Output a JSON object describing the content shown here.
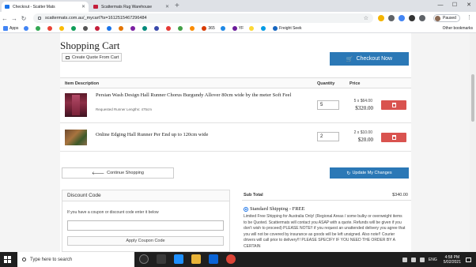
{
  "browser": {
    "tabs": [
      {
        "title": "Checkout - Scatter Mats",
        "active": true
      },
      {
        "title": "Scattermats Rug Warehouse",
        "active": false
      }
    ],
    "url": "scattermats.com.au/_mycart?ts=1612515467296484",
    "profile_label": "Paused",
    "bookmarks": [
      {
        "label": "Apps",
        "icon": "apps-grid-icon"
      },
      {
        "label": "365",
        "icon": "office-icon"
      },
      {
        "label": "YF",
        "icon": "bookmark-icon"
      },
      {
        "label": "Freight Seek",
        "icon": "freight-icon"
      }
    ],
    "other_bookmarks": "Other bookmarks"
  },
  "cart": {
    "title": "Shopping Cart",
    "create_quote_label": "Create Quote From Cart",
    "checkout_label": "Checkout Now",
    "columns": {
      "description": "Item Description",
      "quantity": "Quantity",
      "price": "Price"
    },
    "items": [
      {
        "name": "Persian Wash Design Hall Runner Chorus Burgundy Allover 80cm wide by the meter Soft Feel",
        "note": "Requested Runner Lengths: 475cm",
        "quantity": "5",
        "unit_price": "5 x $64.00",
        "total": "$320.00"
      },
      {
        "name": "Online Edging Hall Runner Per End up to 120cm wide",
        "note": "",
        "quantity": "2",
        "unit_price": "2 x $10.00",
        "total": "$20.00"
      }
    ],
    "continue_label": "Continue Shopping",
    "update_label": "Update My Changes"
  },
  "discount": {
    "heading": "Discount Code",
    "help_text": "If you have a coupon or discount code enter it below",
    "input_value": "",
    "apply_label": "Apply Coupon Code"
  },
  "summary": {
    "subtotal_label": "Sub Total",
    "subtotal_value": "$340.00",
    "shipping_option": "Standard Shipping - FREE",
    "shipping_note": "Limited Free Shipping for Australia Only! (Regional Areas / some bulky or overweight items to be Quoted. Scattermats will contact you ASAP with a quote. Refunds will be given if you don't wish to proceed) PLEASE NOTE!! if you request an unattended delivery you agree that you will not be covered by insurance as goods will be left unsigned. Also note!! Courier drivers will call prior to delivery!!! PLEASE SPECIFY IF YOU NEED THE ORDER BY A CERTAIN"
  },
  "taskbar": {
    "search_placeholder": "Type here to search",
    "language": "ENG",
    "time": "4:58 PM",
    "date": "5/02/2021"
  },
  "colors": {
    "primary_button": "#2b78b6",
    "delete_button": "#d9534f",
    "page_background": "#f4f4f4"
  }
}
